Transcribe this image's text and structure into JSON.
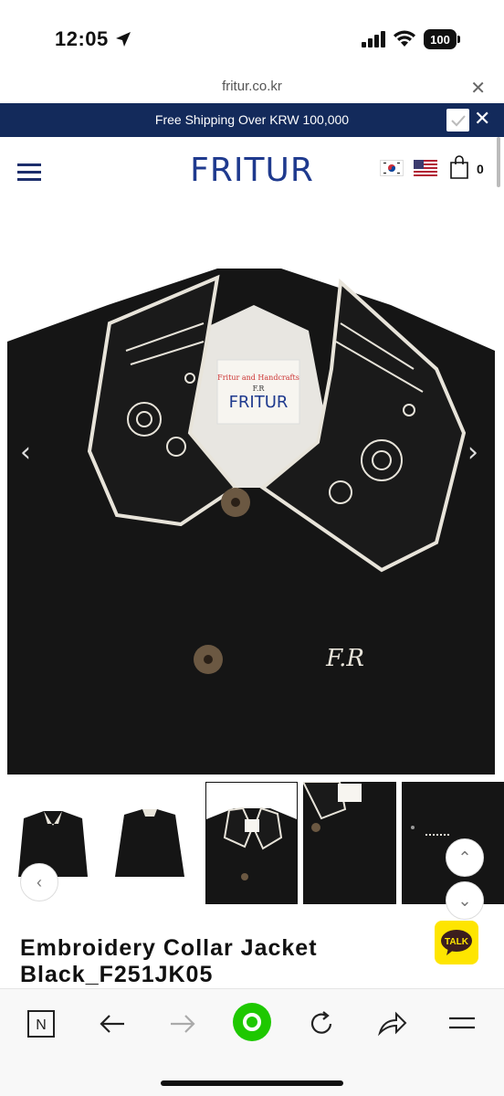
{
  "status_bar": {
    "time": "12:05",
    "battery": "100"
  },
  "browser": {
    "url": "fritur.co.kr",
    "close_icon": "close-icon"
  },
  "banner": {
    "text": "Free Shipping Over KRW 100,000",
    "bg": "#132a5b"
  },
  "header": {
    "logo": "FRITUR",
    "cart_count": "0",
    "brand_color": "#1f3a8e"
  },
  "product_image": {
    "label_line1": "Fritur and Handcrafts",
    "label_line2": "F.R",
    "label_brand": "FRITUR",
    "chest_monogram": "F.R"
  },
  "thumbnails": {
    "count": 5,
    "selected_index": 2
  },
  "product": {
    "title": "Embroidery Collar Jacket Black_F251JK05"
  },
  "chat": {
    "label": "TALK",
    "color": "#fee500"
  },
  "toolbar": {
    "items": [
      "N",
      "back",
      "forward",
      "home",
      "reload",
      "share",
      "menu"
    ],
    "home_color": "#1ec800"
  }
}
